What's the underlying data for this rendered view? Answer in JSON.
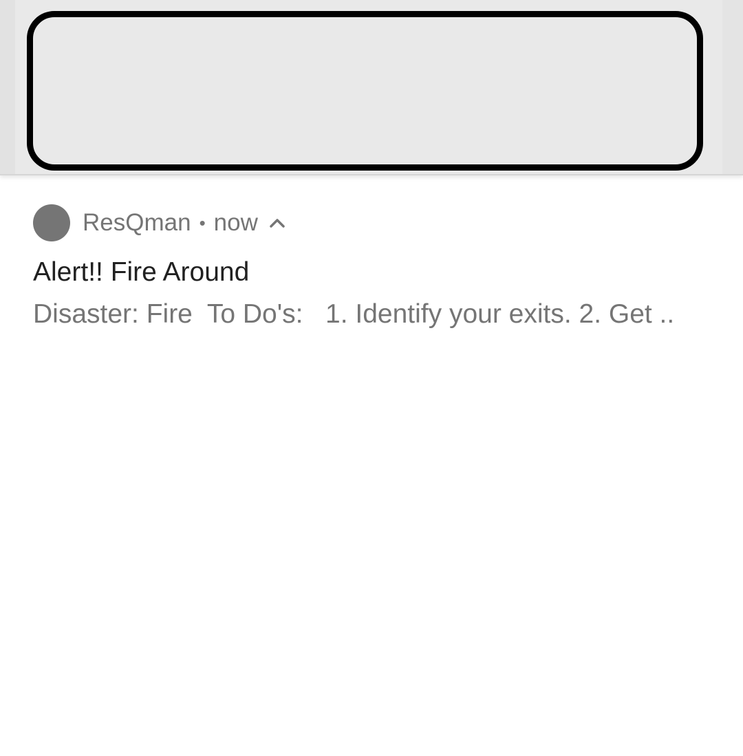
{
  "notification": {
    "app_name": "ResQman",
    "separator": "•",
    "timestamp": "now",
    "expand_icon": "chevron-up-icon",
    "title": "Alert!! Fire Around",
    "body": "Disaster: Fire  To Do's:   1. Identify your exits. 2. Get .."
  },
  "colors": {
    "secondary_text": "#757575",
    "primary_text": "#212121",
    "app_icon": "#757575",
    "highlight_border": "#000000",
    "top_strip": "#e9e9e9"
  }
}
